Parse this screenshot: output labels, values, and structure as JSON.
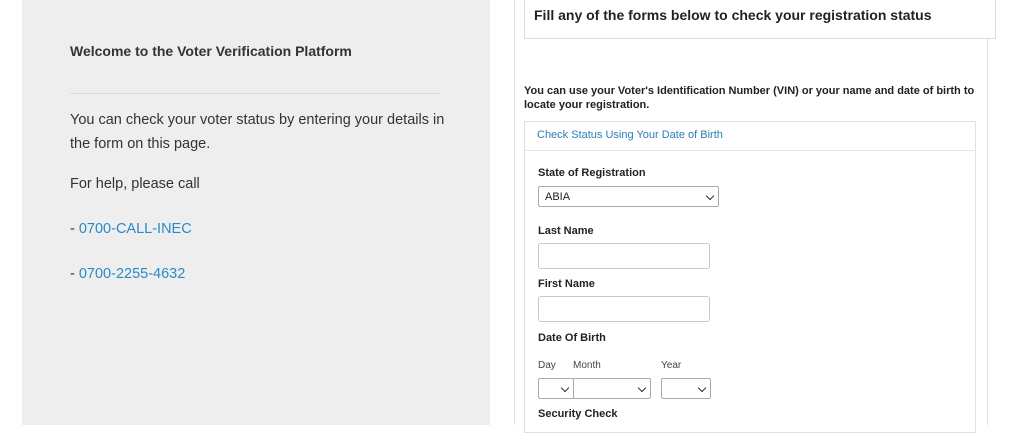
{
  "left": {
    "welcome": "Welcome to the Voter Verification Platform",
    "intro": "You can check your voter status by entering your details in the form on this page.",
    "help": "For help, please call",
    "phones": [
      {
        "prefix": "- ",
        "number": "0700-CALL-INEC"
      },
      {
        "prefix": "- ",
        "number": "0700-2255-4632"
      }
    ]
  },
  "right": {
    "title": "Fill any of the forms below to check your registration status",
    "info": "You can use your Voter's Identification Number (VIN) or your name and date of birth to locate your registration.",
    "panel_heading": "Check Status Using Your Date of Birth",
    "state_label": "State of Registration",
    "state_value": "ABIA",
    "last_name_label": "Last Name",
    "last_name_value": "",
    "first_name_label": "First Name",
    "first_name_value": "",
    "dob_label": "Date Of Birth",
    "day_label": "Day",
    "month_label": "Month",
    "year_label": "Year",
    "day_value": "",
    "month_value": "",
    "year_value": "",
    "security_label": "Security Check"
  },
  "colors": {
    "link": "#2a8ac8",
    "left_bg": "#eeeeee"
  }
}
